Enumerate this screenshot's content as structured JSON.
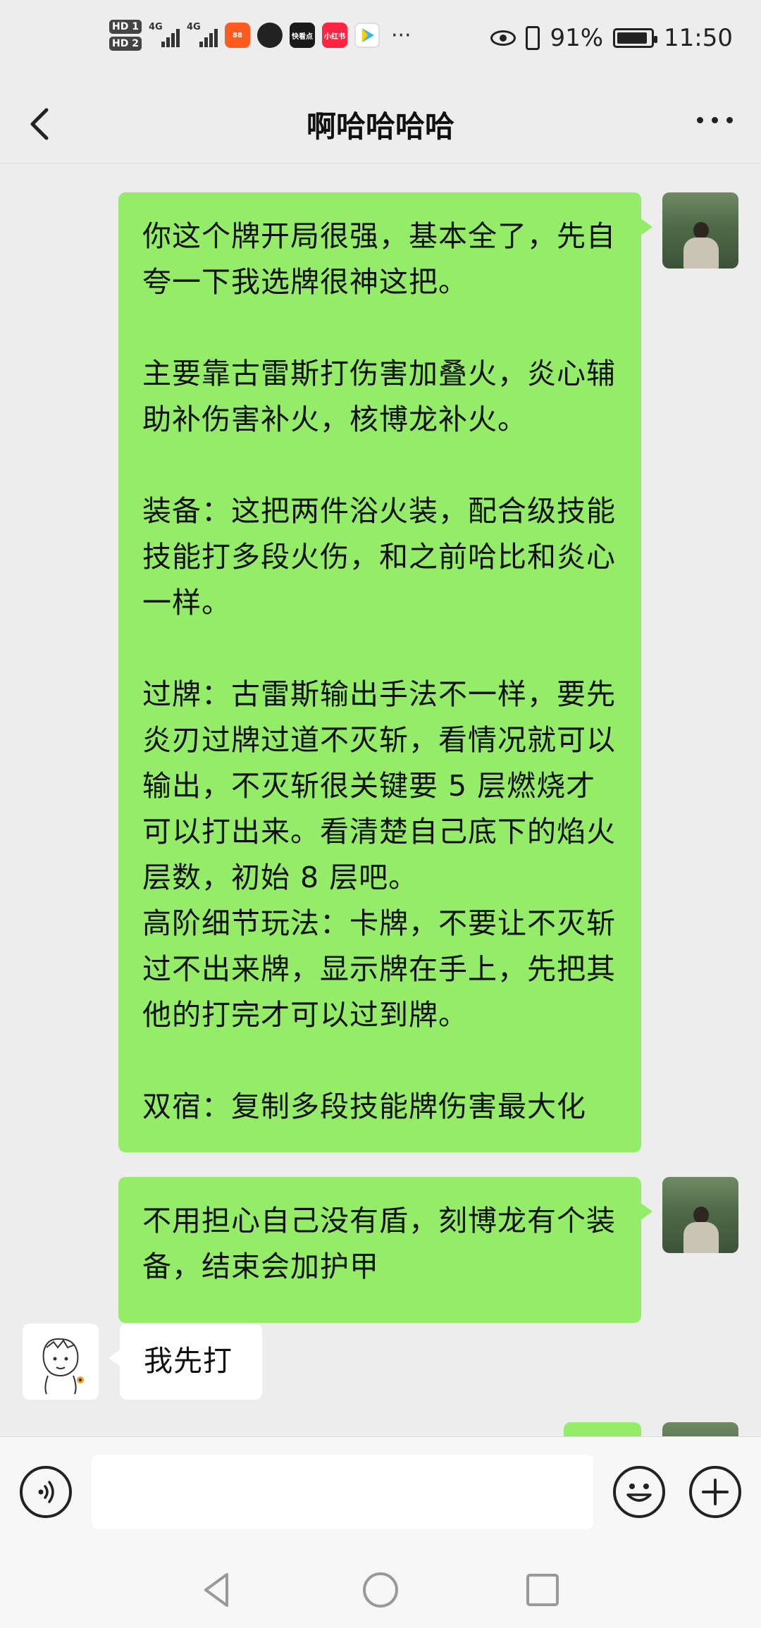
{
  "status_bar": {
    "hd_badges": [
      "HD 1",
      "HD 2"
    ],
    "network_labels": [
      "4G",
      "4G"
    ],
    "apps": [
      {
        "name": "kuaishou-icon",
        "color": "#ff5a1f",
        "text": "88"
      },
      {
        "name": "camera-app-icon",
        "color": "#222222",
        "text": ""
      },
      {
        "name": "news-app-icon",
        "color": "#1a1a1a",
        "text": "快看点"
      },
      {
        "name": "xiaohongshu-icon",
        "color": "#ff2442",
        "text": "小红书"
      },
      {
        "name": "video-app-icon",
        "color": "#2fb6ff",
        "text": ""
      }
    ],
    "more_indicator": "···",
    "battery_percent": "91%",
    "battery_level": 0.91,
    "time": "11:50"
  },
  "header": {
    "title": "啊哈哈哈哈"
  },
  "messages": [
    {
      "sender": "me",
      "paragraphs": [
        "你这个牌开局很强，基本全了，先自夸一下我选牌很神这把。",
        "",
        "主要靠古雷斯打伤害加叠火，炎心辅助补伤害补火，核博龙补火。",
        "",
        "装备：这把两件浴火装，配合级技能技能打多段火伤，和之前哈比和炎心一样。",
        "",
        "过牌：古雷斯输出手法不一样，要先炎刃过牌过道不灭斩，看情况就可以输出，不灭斩很关键要 5 层燃烧才可以打出来。看清楚自己底下的焰火层数，初始 8 层吧。",
        "高阶细节玩法：卡牌，不要让不灭斩过不出来牌，显示牌在手上，先把其他的打完才可以过到牌。",
        "",
        "双宿：复制多段技能牌伤害最大化"
      ]
    },
    {
      "sender": "me",
      "paragraphs": [
        "不用担心自己没有盾，刻博龙有个装备，结束会加护甲"
      ]
    },
    {
      "sender": "other",
      "paragraphs": [
        "我先打"
      ]
    }
  ],
  "input_bar": {
    "voice_icon": "voice-icon",
    "emoji_icon": "emoji-icon",
    "add_icon": "plus-icon",
    "input_value": ""
  },
  "colors": {
    "bubble_me": "#95ec69",
    "bubble_other": "#ffffff",
    "background": "#ededed"
  }
}
